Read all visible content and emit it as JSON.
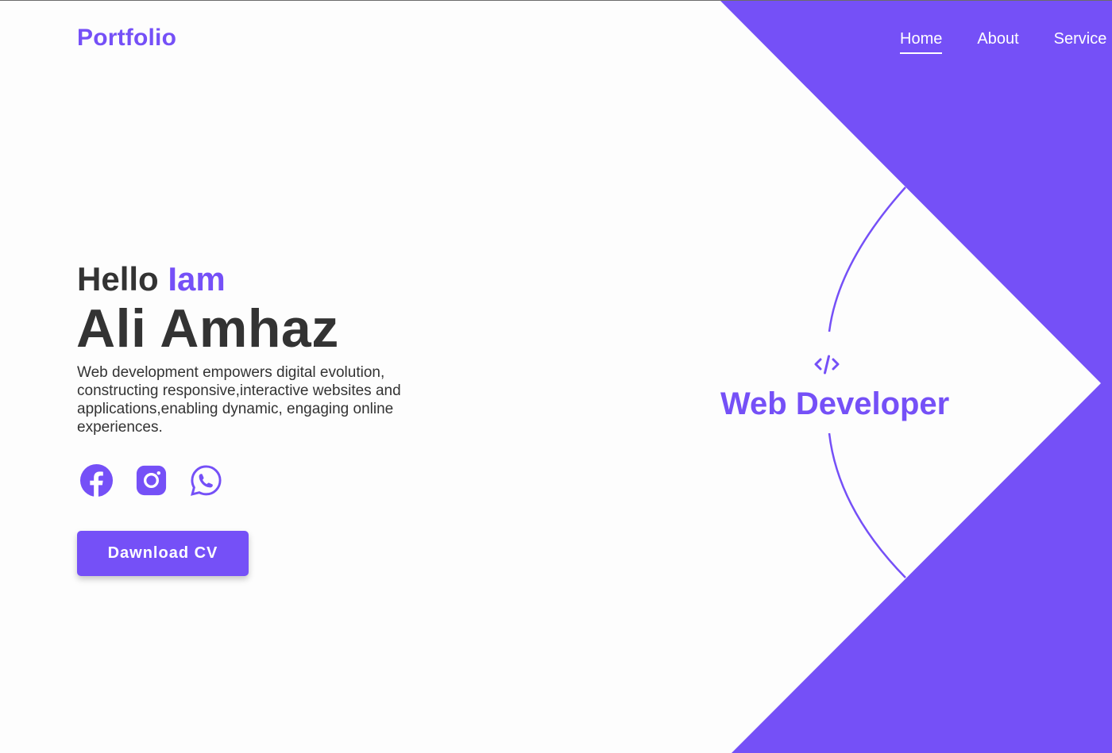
{
  "brand": {
    "logo": "Portfolio",
    "accent_color": "#7550f7"
  },
  "nav": {
    "items": [
      {
        "label": "Home",
        "active": true
      },
      {
        "label": "About",
        "active": false
      },
      {
        "label": "Service",
        "active": false
      }
    ]
  },
  "hero": {
    "greeting": "Hello",
    "greeting_accent": "Iam",
    "name": "Ali Amhaz",
    "description": "Web development empowers digital evolution, constructing responsive,interactive websites and applications,enabling dynamic, engaging online experiences.",
    "socials": [
      {
        "icon": "facebook-icon"
      },
      {
        "icon": "instagram-icon"
      },
      {
        "icon": "whatsapp-icon"
      }
    ],
    "cta_label": "Dawnload CV"
  },
  "role": {
    "icon": "code-icon",
    "title": "Web Developer"
  }
}
